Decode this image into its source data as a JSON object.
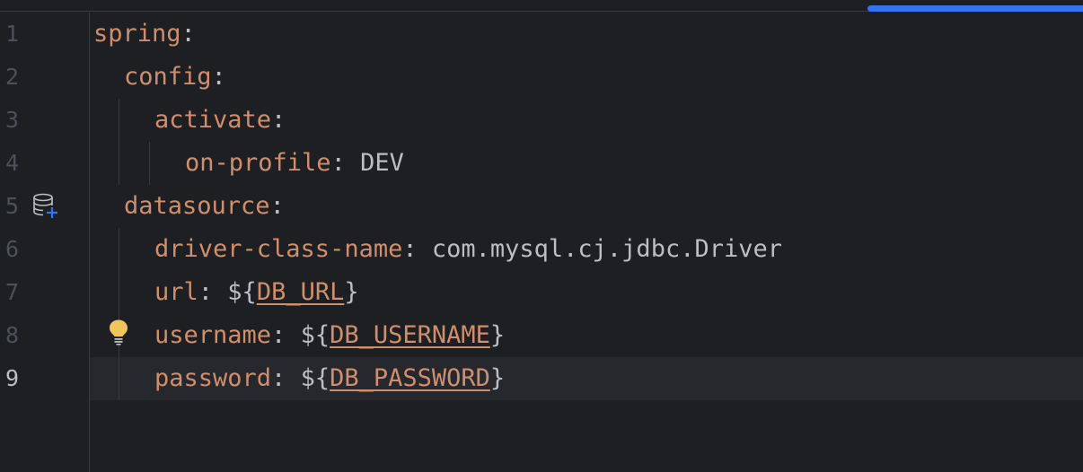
{
  "editor": {
    "lines": [
      {
        "num": "1",
        "key": "spring",
        "colon": ":",
        "value": "",
        "var": "",
        "suffix": ""
      },
      {
        "num": "2",
        "key": "config",
        "colon": ":",
        "value": "",
        "var": "",
        "suffix": ""
      },
      {
        "num": "3",
        "key": "activate",
        "colon": ":",
        "value": "",
        "var": "",
        "suffix": ""
      },
      {
        "num": "4",
        "key": "on-profile",
        "colon": ": ",
        "value": "DEV",
        "var": "",
        "suffix": ""
      },
      {
        "num": "5",
        "key": "datasource",
        "colon": ":",
        "value": "",
        "var": "",
        "suffix": ""
      },
      {
        "num": "6",
        "key": "driver-class-name",
        "colon": ": ",
        "value": "com.mysql.cj.jdbc.Driver",
        "var": "",
        "suffix": ""
      },
      {
        "num": "7",
        "key": "url",
        "colon": ": ",
        "value": "${",
        "var": "DB_URL",
        "suffix": "}"
      },
      {
        "num": "8",
        "key": "username",
        "colon": ": ",
        "value": "${",
        "var": "DB_USERNAME",
        "suffix": "}"
      },
      {
        "num": "9",
        "key": "password",
        "colon": ": ",
        "value": "${",
        "var": "DB_PASSWORD",
        "suffix": "}"
      }
    ],
    "current_line": "9",
    "gutter_icons": {
      "line_5": "database-add-icon",
      "line_8": "lightbulb-icon"
    }
  },
  "colors": {
    "background": "#1e1f22",
    "key": "#cf8e6d",
    "text": "#bcbec4",
    "line_number": "#4b5059",
    "current_line": "#26282e",
    "accent": "#3574f0"
  }
}
